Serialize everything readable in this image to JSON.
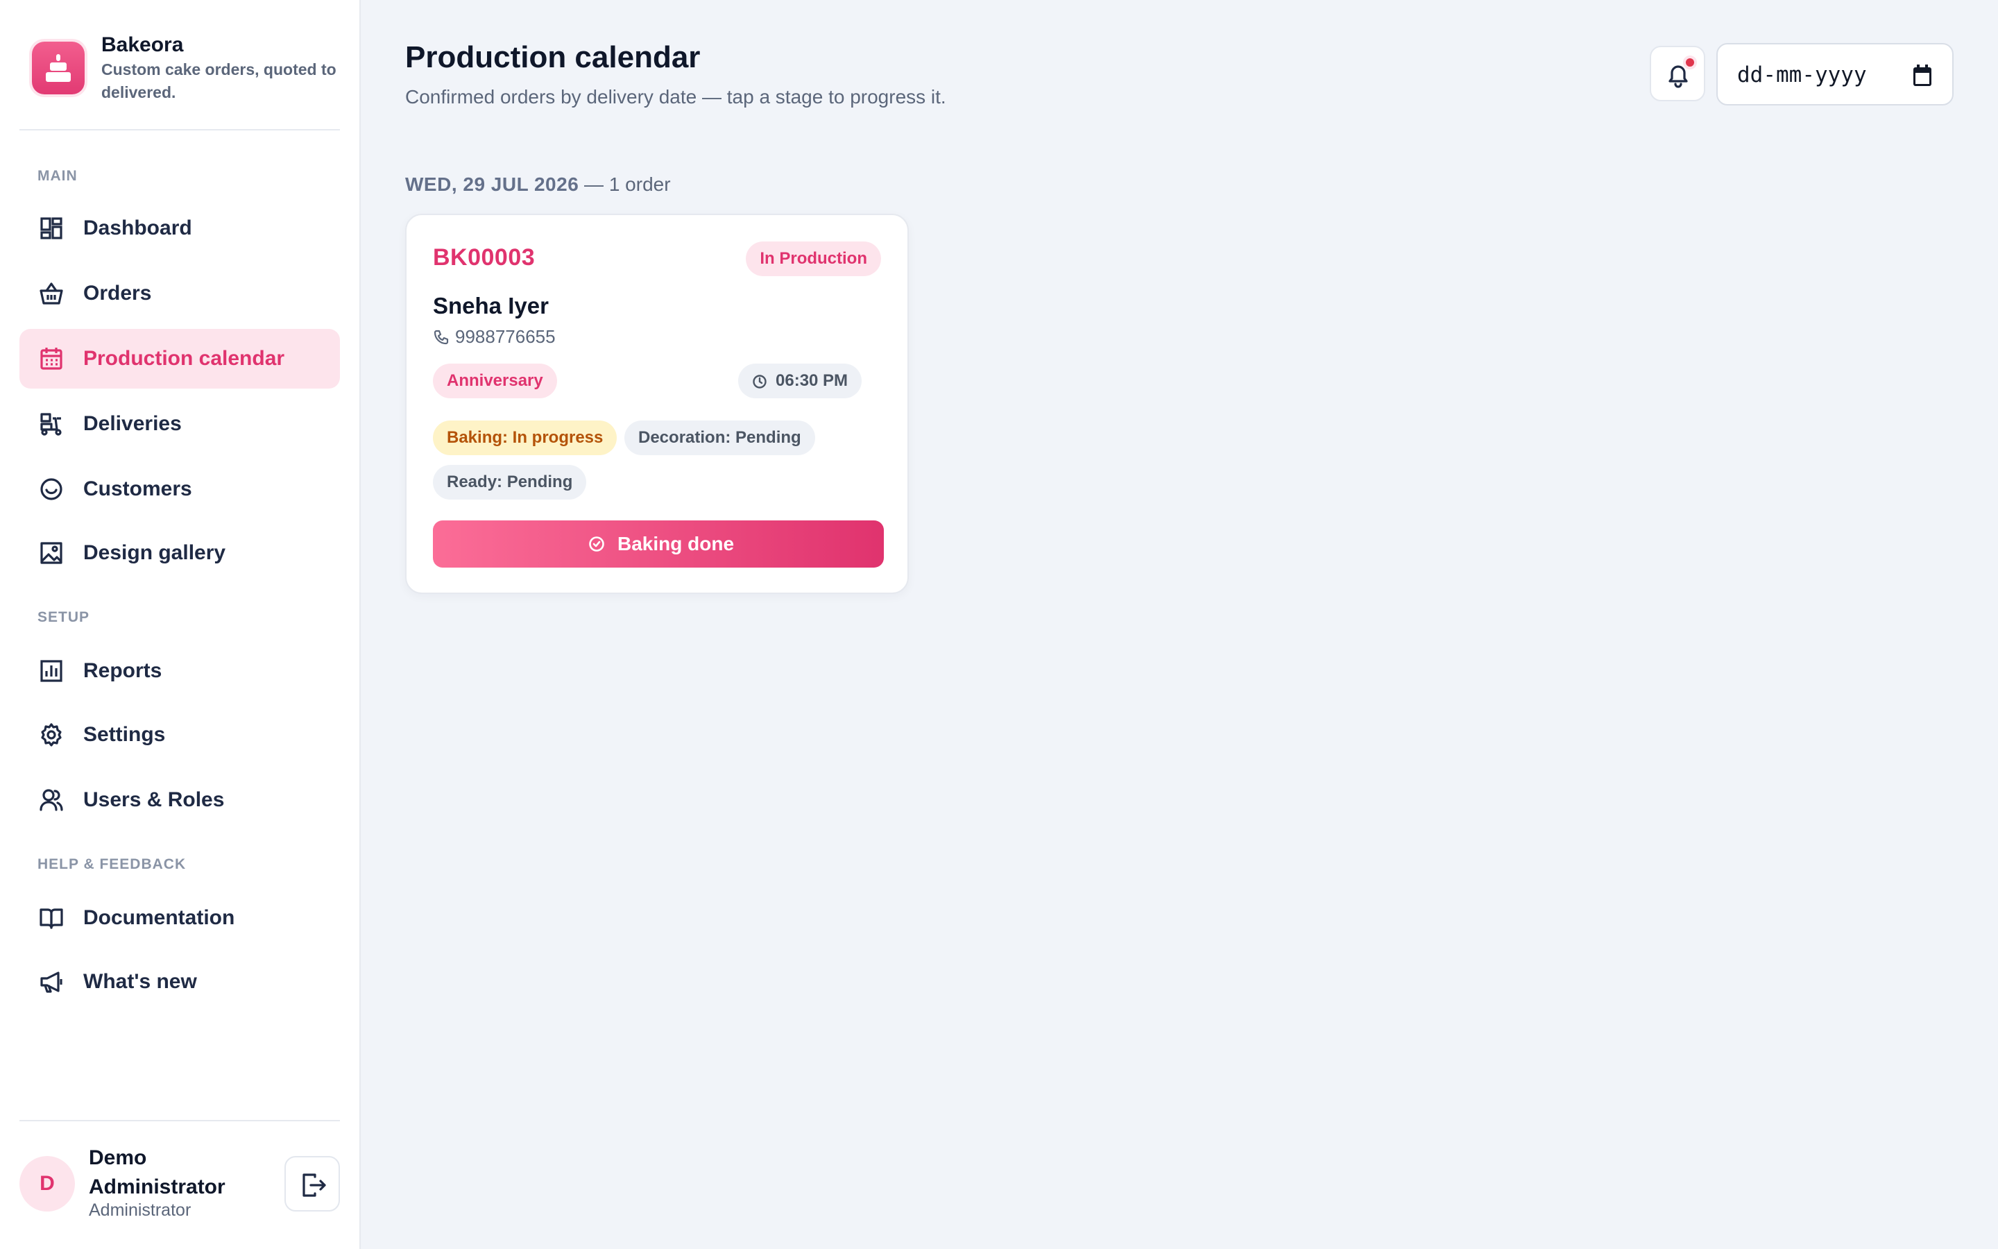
{
  "brand": {
    "name": "Bakeora",
    "tagline": "Custom cake orders, quoted to delivered."
  },
  "sidebar": {
    "sections": [
      {
        "title": "MAIN"
      },
      {
        "title": "SETUP"
      },
      {
        "title": "HELP & FEEDBACK"
      }
    ],
    "items": [
      {
        "label": "Dashboard",
        "icon": "dashboard-icon"
      },
      {
        "label": "Orders",
        "icon": "basket-icon"
      },
      {
        "label": "Production calendar",
        "icon": "calendar-icon",
        "active": true
      },
      {
        "label": "Deliveries",
        "icon": "scooter-icon"
      },
      {
        "label": "Customers",
        "icon": "smile-icon"
      },
      {
        "label": "Design gallery",
        "icon": "image-icon"
      },
      {
        "label": "Reports",
        "icon": "bar-chart-icon"
      },
      {
        "label": "Settings",
        "icon": "gear-icon"
      },
      {
        "label": "Users & Roles",
        "icon": "users-icon"
      },
      {
        "label": "Documentation",
        "icon": "book-icon"
      },
      {
        "label": "What's new",
        "icon": "megaphone-icon"
      }
    ]
  },
  "user": {
    "initial": "D",
    "name": "Demo Administrator",
    "role": "Administrator"
  },
  "header": {
    "title": "Production calendar",
    "subtitle": "Confirmed orders by delivery date — tap a stage to progress it.",
    "date_placeholder": "dd-mm-yyyy"
  },
  "groups": [
    {
      "date": "WED, 29 JUL 2026",
      "count": " — 1 order",
      "orders": [
        {
          "id": "BK00003",
          "status": "In Production",
          "customer": "Sneha Iyer",
          "phone": "9988776655",
          "occasion": "Anniversary",
          "time": "06:30 PM",
          "stages": [
            {
              "label": "Baking: In progress"
            },
            {
              "label": "Decoration: Pending"
            },
            {
              "label": "Ready: Pending"
            }
          ],
          "action": "Baking done"
        }
      ]
    }
  ],
  "colors": {
    "accent": "#e0336e",
    "accent_light": "#fde4ec",
    "background": "#f1f4f9",
    "warning_bg": "#fef3c7",
    "warning_text": "#b45309"
  }
}
